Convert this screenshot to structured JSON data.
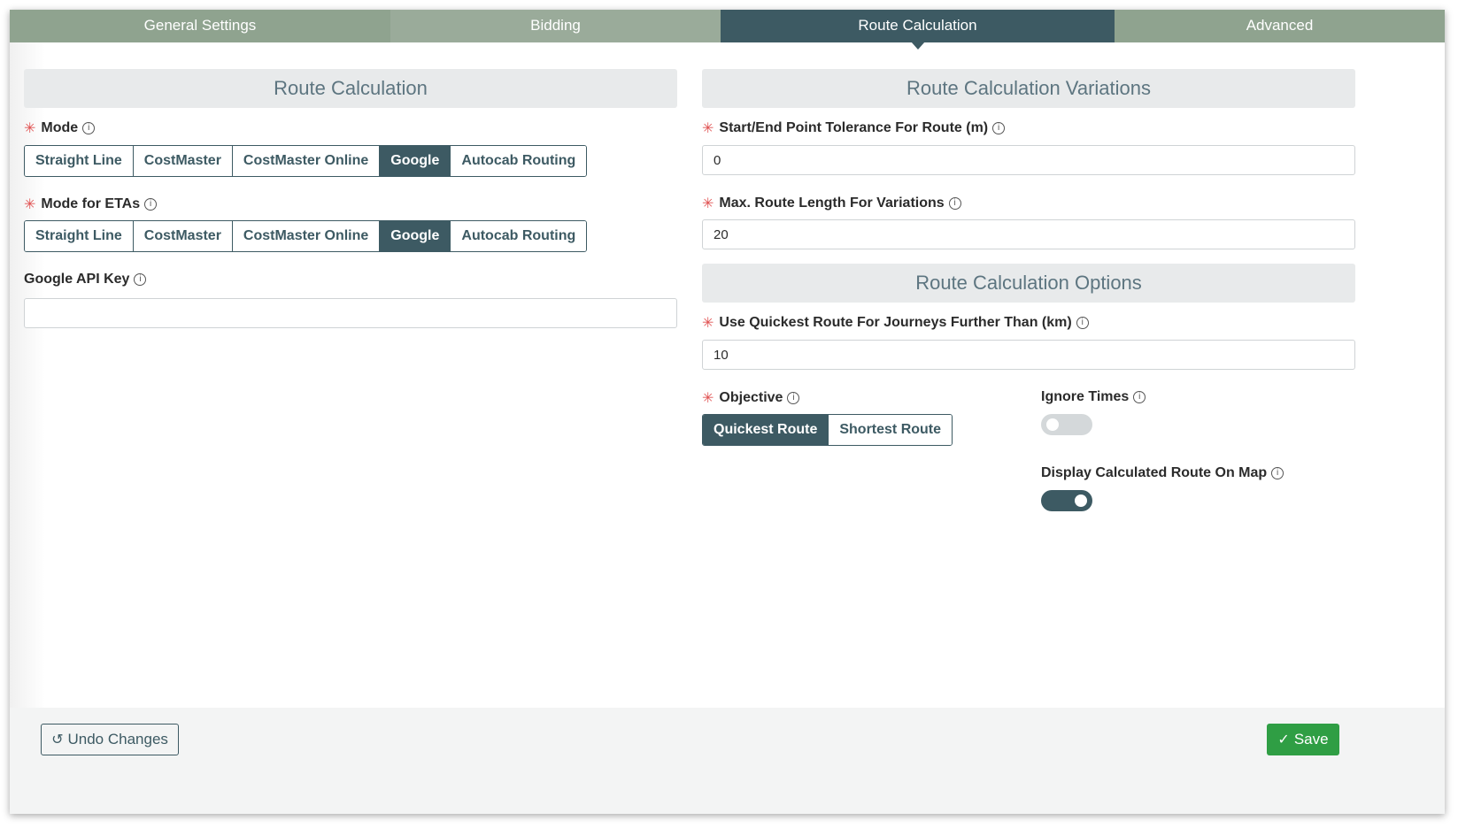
{
  "tabs": [
    {
      "label": "General Settings"
    },
    {
      "label": "Bidding"
    },
    {
      "label": "Route Calculation"
    },
    {
      "label": "Advanced"
    }
  ],
  "left": {
    "header": "Route Calculation",
    "mode": {
      "label": "Mode",
      "options": [
        "Straight Line",
        "CostMaster",
        "CostMaster Online",
        "Google",
        "Autocab Routing"
      ],
      "selected": "Google"
    },
    "mode_etas": {
      "label": "Mode for ETAs",
      "options": [
        "Straight Line",
        "CostMaster",
        "CostMaster Online",
        "Google",
        "Autocab Routing"
      ],
      "selected": "Google"
    },
    "api_key": {
      "label": "Google API Key",
      "value": ""
    }
  },
  "right": {
    "header_variations": "Route Calculation Variations",
    "tolerance": {
      "label": "Start/End Point Tolerance For Route (m)",
      "value": "0"
    },
    "max_length": {
      "label": "Max. Route Length For Variations",
      "value": "20"
    },
    "header_options": "Route Calculation Options",
    "quickest_km": {
      "label": "Use Quickest Route For Journeys Further Than (km)",
      "value": "10"
    },
    "objective": {
      "label": "Objective",
      "options": [
        "Quickest Route",
        "Shortest Route"
      ],
      "selected": "Quickest Route"
    },
    "ignore_times": {
      "label": "Ignore Times",
      "on": false
    },
    "display_route": {
      "label": "Display Calculated Route On Map",
      "on": true
    }
  },
  "footer": {
    "undo_label": "Undo Changes",
    "save_label": "Save"
  },
  "colors": {
    "accent": "#3d5a63",
    "tab_inactive": "#8fa38f",
    "save": "#2f9e44",
    "required": "#e05252"
  }
}
